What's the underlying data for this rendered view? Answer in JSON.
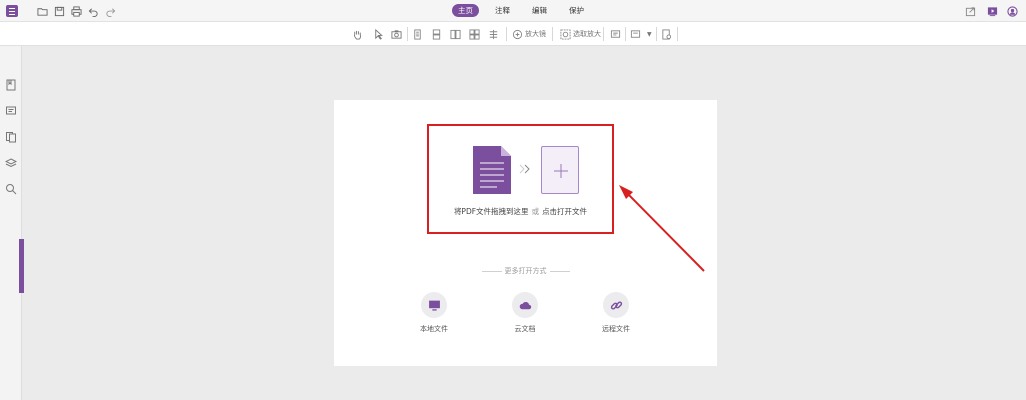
{
  "titlebar": {
    "tabs": [
      {
        "label": "主页",
        "active": true
      },
      {
        "label": "注释",
        "active": false
      },
      {
        "label": "编辑",
        "active": false
      },
      {
        "label": "保护",
        "active": false
      }
    ],
    "quick_access_icons": [
      "open-folder-icon",
      "save-icon",
      "print-icon",
      "undo-icon",
      "redo-icon"
    ],
    "right_icons": [
      "share-icon",
      "media-icon",
      "account-icon"
    ]
  },
  "toolbar": {
    "magnifier_label": "放大镜",
    "area_zoom_label": "选取放大"
  },
  "page": {
    "drop_text": "将PDF文件拖拽到这里",
    "or_text": "或",
    "click_open_text": "点击打开文件",
    "more_ways": "更多打开方式",
    "options": [
      {
        "label": "本地文件",
        "icon": "monitor-icon"
      },
      {
        "label": "云文档",
        "icon": "cloud-icon"
      },
      {
        "label": "远程文件",
        "icon": "link-icon"
      }
    ]
  },
  "colors": {
    "accent": "#7b4f9e",
    "highlight_border": "#d7201f",
    "canvas": "#ebebeb"
  }
}
